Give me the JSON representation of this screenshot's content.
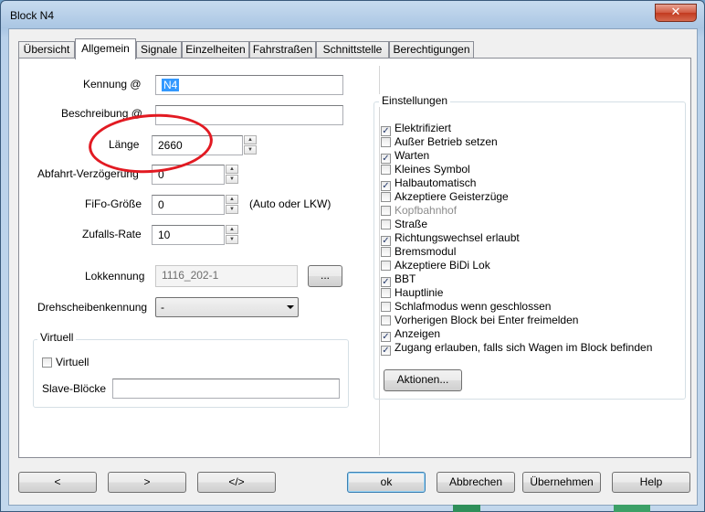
{
  "window": {
    "title": "Block N4",
    "close_glyph": "✕"
  },
  "tabs": [
    {
      "label": "Übersicht"
    },
    {
      "label": "Allgemein"
    },
    {
      "label": "Signale"
    },
    {
      "label": "Einzelheiten"
    },
    {
      "label": "Fahrstraßen"
    },
    {
      "label": "Schnittstelle"
    },
    {
      "label": "Berechtigungen"
    }
  ],
  "general": {
    "kennung": {
      "label": "Kennung @",
      "value": "N4"
    },
    "beschreibung": {
      "label": "Beschreibung @",
      "value": ""
    },
    "laenge": {
      "label": "Länge",
      "value": "2660"
    },
    "abfahrt": {
      "label": "Abfahrt-Verzögerung",
      "value": "0"
    },
    "fifo": {
      "label": "FiFo-Größe",
      "value": "0",
      "hint": "(Auto oder LKW)"
    },
    "zufall": {
      "label": "Zufalls-Rate",
      "value": "10"
    },
    "lokkennung": {
      "label": "Lokkennung",
      "value": "1116_202-1",
      "button": "..."
    },
    "drehscheibe": {
      "label": "Drehscheibenkennung",
      "value": "-"
    }
  },
  "virtuell": {
    "title": "Virtuell",
    "checkbox_label": "Virtuell",
    "checked": false,
    "slave_label": "Slave-Blöcke",
    "slave_value": ""
  },
  "einstellungen": {
    "title": "Einstellungen",
    "items": [
      {
        "label": "Elektrifiziert",
        "checked": true,
        "disabled": false
      },
      {
        "label": "Außer Betrieb setzen",
        "checked": false,
        "disabled": false
      },
      {
        "label": "Warten",
        "checked": true,
        "disabled": false
      },
      {
        "label": "Kleines Symbol",
        "checked": false,
        "disabled": false
      },
      {
        "label": "Halbautomatisch",
        "checked": true,
        "disabled": false
      },
      {
        "label": "Akzeptiere Geisterzüge",
        "checked": false,
        "disabled": false
      },
      {
        "label": "Kopfbahnhof",
        "checked": false,
        "disabled": true
      },
      {
        "label": "Straße",
        "checked": false,
        "disabled": false
      },
      {
        "label": "Richtungswechsel erlaubt",
        "checked": true,
        "disabled": false
      },
      {
        "label": "Bremsmodul",
        "checked": false,
        "disabled": false
      },
      {
        "label": "Akzeptiere BiDi Lok",
        "checked": false,
        "disabled": false
      },
      {
        "label": "BBT",
        "checked": true,
        "disabled": false
      },
      {
        "label": "Hauptlinie",
        "checked": false,
        "disabled": false
      },
      {
        "label": "Schlafmodus wenn geschlossen",
        "checked": false,
        "disabled": false
      },
      {
        "label": "Vorherigen Block bei Enter freimelden",
        "checked": false,
        "disabled": false
      },
      {
        "label": "Anzeigen",
        "checked": true,
        "disabled": false
      },
      {
        "label": "Zugang erlauben, falls sich Wagen im Block befinden",
        "checked": true,
        "disabled": false
      }
    ],
    "actions_button": "Aktionen..."
  },
  "footer": {
    "prev": "<",
    "next": ">",
    "code": "</>",
    "ok": "ok",
    "cancel": "Abbrechen",
    "apply": "Übernehmen",
    "help": "Help"
  },
  "colors": {
    "annotation_circle": "#e21a22",
    "selection": "#3399ff"
  }
}
